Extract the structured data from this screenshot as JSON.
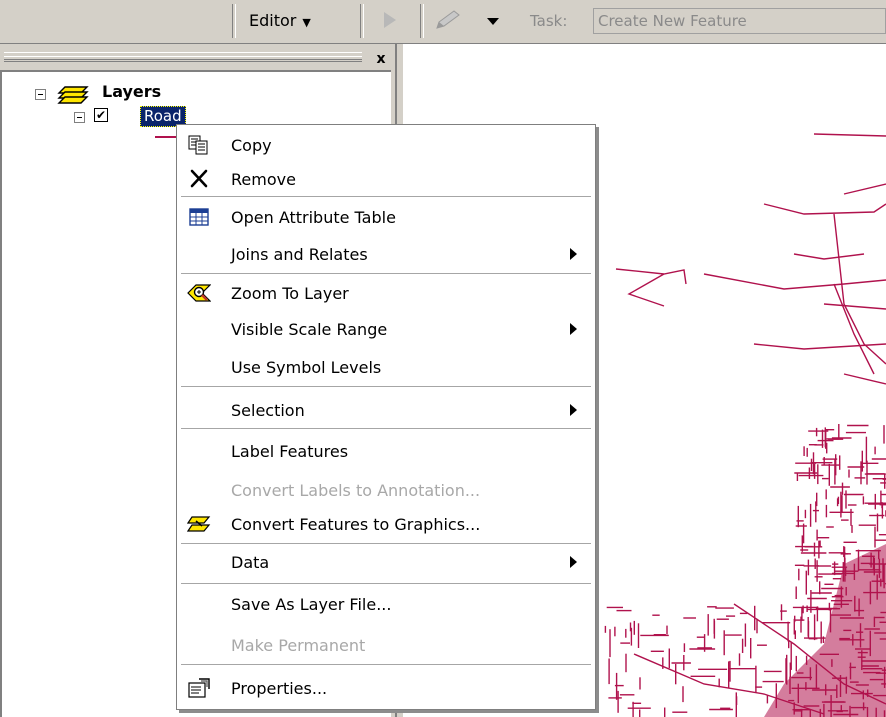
{
  "toolbar": {
    "editor_label": "Editor",
    "task_label": "Task:",
    "task_value": "Create New Feature"
  },
  "toc": {
    "close_glyph": "x",
    "root_label": "Layers",
    "layer_label": "Road",
    "layer_checked": "✔",
    "symbol_color": "#b0124d"
  },
  "context_menu": {
    "items": [
      {
        "label": "Copy",
        "icon": "copy-icon",
        "enabled": true
      },
      {
        "label": "Remove",
        "icon": "remove-icon",
        "enabled": true
      },
      {
        "label": "Open Attribute Table",
        "icon": "table-icon",
        "enabled": true
      },
      {
        "label": "Joins and Relates",
        "submenu": true,
        "enabled": true
      },
      {
        "label": "Zoom To Layer",
        "icon": "zoom-to-layer-icon",
        "enabled": true
      },
      {
        "label": "Visible Scale Range",
        "submenu": true,
        "enabled": true
      },
      {
        "label": "Use Symbol Levels",
        "enabled": true
      },
      {
        "label": "Selection",
        "submenu": true,
        "enabled": true
      },
      {
        "label": "Label Features",
        "enabled": true
      },
      {
        "label": "Convert Labels to Annotation...",
        "enabled": false
      },
      {
        "label": "Convert Features to Graphics...",
        "icon": "convert-graphics-icon",
        "enabled": true
      },
      {
        "label": "Data",
        "submenu": true,
        "enabled": true
      },
      {
        "label": "Save As Layer File...",
        "enabled": true
      },
      {
        "label": "Make Permanent",
        "enabled": false
      },
      {
        "label": "Properties...",
        "icon": "properties-icon",
        "enabled": true
      }
    ]
  },
  "colors": {
    "road": "#b0124d",
    "selection": "#0a246a",
    "panel": "#d4d0c8"
  }
}
